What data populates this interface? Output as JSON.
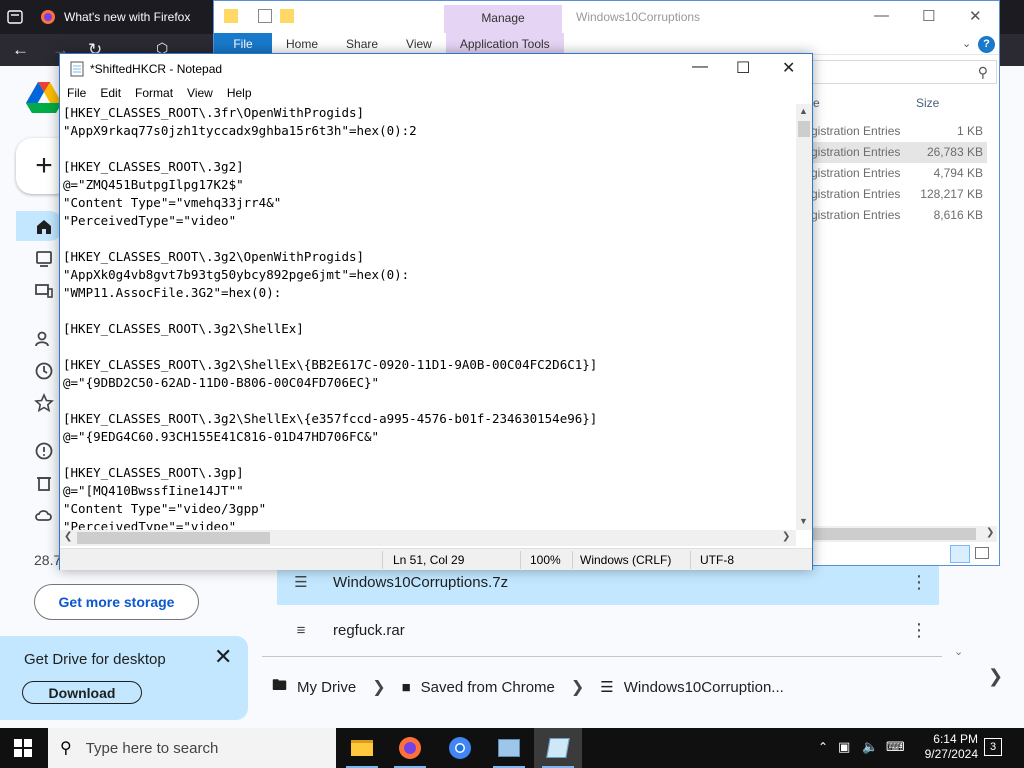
{
  "firefox": {
    "tab_title": "What's new with Firefox"
  },
  "drive": {
    "storage_text": "28.7",
    "get_storage_label": "Get more storage",
    "promo_title": "Get Drive for desktop",
    "promo_download_label": "Download",
    "files": [
      {
        "name": "Windows10Corruptions.7z"
      },
      {
        "name": "regfuck.rar"
      }
    ],
    "breadcrumb": [
      "My Drive",
      "Saved from Chrome",
      "Windows10Corruption..."
    ]
  },
  "explorer": {
    "title": "Windows10Corruptions",
    "manage_label": "Manage",
    "ribbon_tabs": [
      "File",
      "Home",
      "Share",
      "View",
      "Application Tools"
    ],
    "header_type": "e",
    "header_size": "Size",
    "rows": [
      {
        "type": "gistration Entries",
        "size": "1 KB"
      },
      {
        "type": "gistration Entries",
        "size": "26,783 KB"
      },
      {
        "type": "gistration Entries",
        "size": "4,794 KB"
      },
      {
        "type": "gistration Entries",
        "size": "128,217 KB"
      },
      {
        "type": "gistration Entries",
        "size": "8,616 KB"
      }
    ]
  },
  "notepad": {
    "title": "*ShiftedHKCR - Notepad",
    "menu": [
      "File",
      "Edit",
      "Format",
      "View",
      "Help"
    ],
    "content": "[HKEY_CLASSES_ROOT\\.3fr\\OpenWithProgids]\n\"AppX9rkaq77s0jzh1tyccadx9ghba15r6t3h\"=hex(0):2\n\n[HKEY_CLASSES_ROOT\\.3g2]\n@=\"ZMQ451ButpgIlpg17K2$\"\n\"Content Type\"=\"vmehq33jrr4&\"\n\"PerceivedType\"=\"video\"\n\n[HKEY_CLASSES_ROOT\\.3g2\\OpenWithProgids]\n\"AppXk0g4vb8gvt7b93tg50ybcy892pge6jmt\"=hex(0):\n\"WMP11.AssocFile.3G2\"=hex(0):\n\n[HKEY_CLASSES_ROOT\\.3g2\\ShellEx]\n\n[HKEY_CLASSES_ROOT\\.3g2\\ShellEx\\{BB2E617C-0920-11D1-9A0B-00C04FC2D6C1}]\n@=\"{9DBD2C50-62AD-11D0-B806-00C04FD706EC}\"\n\n[HKEY_CLASSES_ROOT\\.3g2\\ShellEx\\{e357fccd-a995-4576-b01f-234630154e96}]\n@=\"{9EDG4C60.93CH155E41C816-01D47HD706FC&\"\n\n[HKEY_CLASSES_ROOT\\.3gp]\n@=\"[MQ410BwssfIine14JT\"\"\n\"Content Type\"=\"video/3gpp\"\n\"PerceivedType\"=\"video\"",
    "status": {
      "position": "Ln 51, Col 29",
      "zoom": "100%",
      "line_endings": "Windows (CRLF)",
      "encoding": "UTF-8"
    }
  },
  "taskbar": {
    "search_placeholder": "Type here to search",
    "time": "6:14 PM",
    "date": "9/27/2024",
    "notification_count": "3"
  },
  "colors": {
    "drive_accent": "#c2e7ff",
    "drive_link": "#0b57d0",
    "explorer_file_tab": "#1979ca",
    "explorer_manage": "#e6d4f5",
    "taskbar": "#101010"
  },
  "icons": [
    "firefox-icon",
    "google-drive-logo",
    "plus-icon",
    "home-icon",
    "computer-icon",
    "people-icon",
    "clock-icon",
    "star-icon",
    "spam-icon",
    "trash-icon",
    "cloud-icon",
    "close-icon",
    "zip-file-icon",
    "rar-file-icon",
    "folder-icon",
    "more-vert-icon",
    "chevron-right-icon",
    "search-icon",
    "notepad-icon",
    "windows-start-icon",
    "file-explorer-icon",
    "chrome-icon",
    "wifi-icon",
    "volume-icon",
    "notification-icon"
  ]
}
